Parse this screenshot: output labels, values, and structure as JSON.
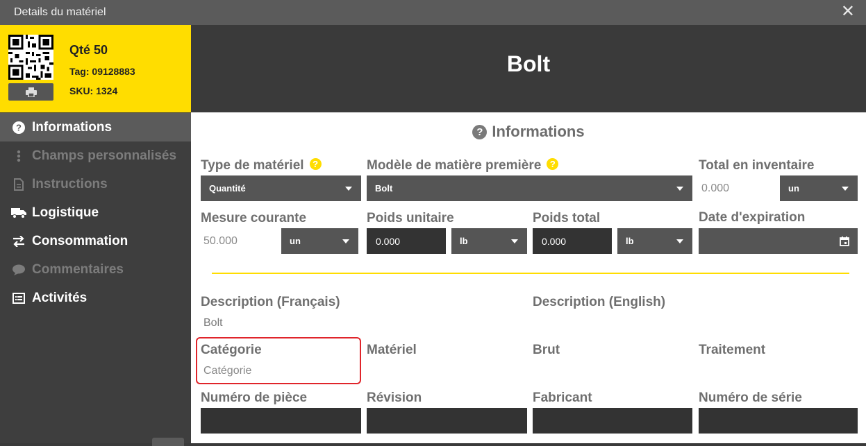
{
  "window": {
    "title": "Details du matériel",
    "close_icon": "close-icon"
  },
  "badge": {
    "qty": "Qté 50",
    "tag": "Tag: 09128883",
    "sku": "SKU: 1324",
    "print_icon": "printer-icon"
  },
  "nav": {
    "items": [
      {
        "label": "Informations",
        "icon": "question-circle-icon",
        "state": "active"
      },
      {
        "label": "Champs personnalisés",
        "icon": "vertical-dots-icon",
        "state": "disabled"
      },
      {
        "label": "Instructions",
        "icon": "document-icon",
        "state": "disabled"
      },
      {
        "label": "Logistique",
        "icon": "truck-icon",
        "state": "enabled"
      },
      {
        "label": "Consommation",
        "icon": "swap-arrows-icon",
        "state": "enabled"
      },
      {
        "label": "Commentaires",
        "icon": "comment-icon",
        "state": "disabled"
      },
      {
        "label": "Activités",
        "icon": "list-icon",
        "state": "enabled"
      }
    ]
  },
  "header": {
    "name": "Bolt"
  },
  "section": {
    "title": "Informations"
  },
  "fields": {
    "type_label": "Type de matériel",
    "type_value": "Quantité",
    "model_label": "Modèle de matière première",
    "model_value": "Bolt",
    "total_label": "Total en inventaire",
    "total_value": "0.000",
    "total_unit": "un",
    "mesure_label": "Mesure courante",
    "mesure_value": "50.000",
    "mesure_unit": "un",
    "poids_unit_label": "Poids unitaire",
    "poids_unit_value": "0.000",
    "poids_unit_unit": "lb",
    "poids_total_label": "Poids total",
    "poids_total_value": "0.000",
    "poids_total_unit": "lb",
    "expiration_label": "Date d'expiration",
    "desc_fr_label": "Description (Français)",
    "desc_fr_value": "Bolt",
    "desc_en_label": "Description (English)",
    "categorie_label": "Catégorie",
    "categorie_value": "Catégorie",
    "materiel_label": "Matériel",
    "brut_label": "Brut",
    "traitement_label": "Traitement",
    "numero_piece_label": "Numéro de pièce",
    "revision_label": "Révision",
    "fabricant_label": "Fabricant",
    "numero_serie_label": "Numéro de série"
  },
  "colors": {
    "accent": "#ffdd00",
    "sidebar": "#3e3e3e",
    "highlight": "#e0252b"
  }
}
